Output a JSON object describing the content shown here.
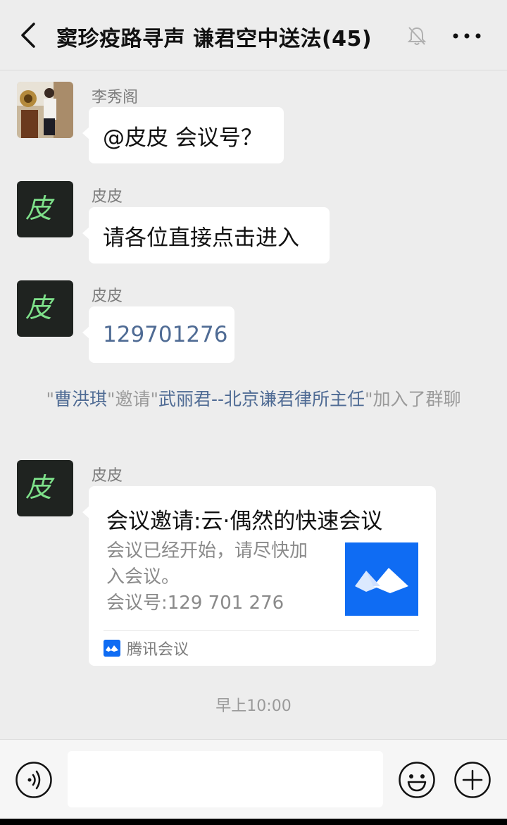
{
  "header": {
    "title": "窦珍疫路寻声  谦君空中送法(45)"
  },
  "messages": [
    {
      "sender": "李秀阁",
      "text": "@皮皮  会议号？"
    },
    {
      "sender": "皮皮",
      "text": "请各位直接点击进入"
    },
    {
      "sender": "皮皮",
      "text": "129701276"
    }
  ],
  "system_notice": {
    "q1": "\"",
    "inviter": "曹洪琪",
    "q2": "\"邀请\"",
    "invitee": "武丽君--北京谦君律所主任",
    "q3": "\"加入了群聊"
  },
  "card_message": {
    "sender": "皮皮",
    "title": "会议邀请:云·偶然的快速会议",
    "desc_line1": "会议已经开始，请尽快加",
    "desc_line2": "入会议。",
    "meeting_id": "会议号:129 701 276",
    "source": "腾讯会议"
  },
  "timestamp": "早上10:00",
  "input": {
    "value": "",
    "placeholder": ""
  },
  "colors": {
    "background": "#ededed",
    "link_blue": "#4f6b94",
    "tencent_meeting_blue": "#0f6cf3",
    "avatar_glow_green": "#7ee08a"
  }
}
